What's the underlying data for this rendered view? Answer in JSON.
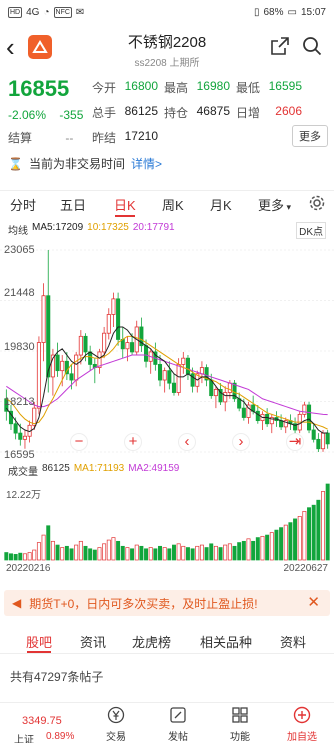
{
  "status_bar": {
    "left_chip": "HD",
    "carrier": "4G",
    "chip2": "NFC",
    "battery": "68%",
    "time": "15:07"
  },
  "header": {
    "title": "不锈钢2208",
    "subtitle": "ss2208 上期所"
  },
  "quote": {
    "price": "16855",
    "change_pct": "-2.06%",
    "change_abs": "-355",
    "rows": [
      [
        {
          "label": "今开",
          "value": "16800",
          "color": "green"
        },
        {
          "label": "最高",
          "value": "16980",
          "color": "green"
        },
        {
          "label": "最低",
          "value": "16595",
          "color": "green"
        }
      ],
      [
        {
          "label": "总手",
          "value": "86125",
          "color": "black"
        },
        {
          "label": "持仓",
          "value": "46875",
          "color": "black"
        },
        {
          "label": "日增",
          "value": "2606",
          "color": "red"
        }
      ],
      [
        {
          "label": "昨结",
          "value": "17210",
          "color": "black"
        }
      ]
    ],
    "settle_label": "结算",
    "settle_value": "--",
    "more_label": "更多"
  },
  "notice": {
    "text": "当前为非交易时间",
    "detail": "详情>"
  },
  "tabs": [
    "分时",
    "五日",
    "日K",
    "周K",
    "月K",
    "更多"
  ],
  "active_tab": "日K",
  "ma_legend": {
    "label": "均线",
    "ma5": "MA5:17209",
    "ma10": "10:17325",
    "ma20": "20:17791",
    "dk": "DK点"
  },
  "price_axis": [
    "23065",
    "21448",
    "19830",
    "18213",
    "16595"
  ],
  "chart_data": {
    "type": "candlestick",
    "x_start": "20220216",
    "x_end": "20220627",
    "ylim": [
      16595,
      23065
    ],
    "ohlc": [
      [
        18300,
        18600,
        17600,
        17900
      ],
      [
        17900,
        18100,
        17300,
        17500
      ],
      [
        17500,
        17700,
        17000,
        17200
      ],
      [
        17200,
        17500,
        16800,
        17000
      ],
      [
        17000,
        17300,
        16700,
        17100
      ],
      [
        17100,
        17600,
        16900,
        17450
      ],
      [
        17450,
        18200,
        17300,
        18000
      ],
      [
        18000,
        20300,
        17800,
        20100
      ],
      [
        20100,
        22000,
        19500,
        21600
      ],
      [
        21600,
        23065,
        18500,
        19000
      ],
      [
        19000,
        19900,
        18400,
        19700
      ],
      [
        19700,
        20100,
        19000,
        19200
      ],
      [
        19200,
        19700,
        18700,
        19500
      ],
      [
        19500,
        19800,
        18900,
        19100
      ],
      [
        19100,
        19400,
        18600,
        18900
      ],
      [
        18900,
        19800,
        18700,
        19700
      ],
      [
        19700,
        20500,
        19400,
        20300
      ],
      [
        20300,
        20400,
        19500,
        19800
      ],
      [
        19800,
        20000,
        19200,
        19400
      ],
      [
        19400,
        19600,
        18800,
        19300
      ],
      [
        19300,
        19900,
        19100,
        19800
      ],
      [
        19800,
        20600,
        19600,
        20400
      ],
      [
        20400,
        21200,
        20200,
        21000
      ],
      [
        21000,
        21700,
        20600,
        21500
      ],
      [
        21500,
        21700,
        20000,
        20200
      ],
      [
        20200,
        20600,
        19600,
        19900
      ],
      [
        19900,
        20300,
        19500,
        20100
      ],
      [
        20100,
        20400,
        19700,
        19800
      ],
      [
        19800,
        20800,
        19700,
        20600
      ],
      [
        20600,
        20900,
        19800,
        20000
      ],
      [
        20000,
        20200,
        19300,
        19500
      ],
      [
        19500,
        19900,
        19100,
        19800
      ],
      [
        19800,
        20100,
        19200,
        19400
      ],
      [
        19400,
        19700,
        18700,
        18900
      ],
      [
        18900,
        19300,
        18500,
        19200
      ],
      [
        19200,
        19500,
        18600,
        18800
      ],
      [
        18800,
        19100,
        18400,
        18500
      ],
      [
        18500,
        19600,
        18400,
        19400
      ],
      [
        19400,
        19800,
        19100,
        19600
      ],
      [
        19600,
        19700,
        18900,
        19100
      ],
      [
        19100,
        19300,
        18500,
        18700
      ],
      [
        18700,
        19200,
        18500,
        19100
      ],
      [
        19100,
        19500,
        18800,
        19300
      ],
      [
        19300,
        19400,
        18700,
        18900
      ],
      [
        18900,
        19100,
        18300,
        18400
      ],
      [
        18400,
        18700,
        18000,
        18600
      ],
      [
        18600,
        18800,
        18100,
        18200
      ],
      [
        18200,
        18700,
        17900,
        18500
      ],
      [
        18500,
        18900,
        18300,
        18800
      ],
      [
        18800,
        18900,
        18200,
        18300
      ],
      [
        18300,
        18500,
        17900,
        18000
      ],
      [
        18000,
        18300,
        17600,
        17700
      ],
      [
        17700,
        18200,
        17500,
        18100
      ],
      [
        18100,
        18400,
        17800,
        17900
      ],
      [
        17900,
        18100,
        17500,
        17600
      ],
      [
        17600,
        17900,
        17300,
        17800
      ],
      [
        17800,
        18000,
        17400,
        17500
      ],
      [
        17500,
        17800,
        17200,
        17700
      ],
      [
        17700,
        17900,
        17400,
        17600
      ],
      [
        17600,
        17800,
        17300,
        17400
      ],
      [
        17400,
        17700,
        17200,
        17600
      ],
      [
        17600,
        17800,
        17300,
        17500
      ],
      [
        17500,
        17700,
        17200,
        17300
      ],
      [
        17300,
        17900,
        17200,
        17800
      ],
      [
        17800,
        18200,
        17700,
        18100
      ],
      [
        18100,
        18200,
        17200,
        17300
      ],
      [
        17300,
        17500,
        16900,
        17000
      ],
      [
        17000,
        17200,
        16595,
        16700
      ],
      [
        16700,
        17300,
        16600,
        17200
      ],
      [
        17200,
        17300,
        16700,
        16855
      ]
    ],
    "volumes": [
      12,
      10,
      9,
      11,
      10,
      12,
      16,
      28,
      40,
      55,
      30,
      24,
      20,
      22,
      18,
      24,
      30,
      22,
      18,
      16,
      20,
      26,
      32,
      36,
      30,
      22,
      20,
      18,
      24,
      22,
      18,
      20,
      18,
      22,
      20,
      18,
      24,
      26,
      22,
      20,
      18,
      22,
      24,
      20,
      26,
      22,
      20,
      24,
      26,
      22,
      28,
      30,
      34,
      30,
      36,
      38,
      40,
      44,
      48,
      52,
      56,
      60,
      66,
      70,
      78,
      84,
      88,
      96,
      110,
      122
    ],
    "ma5": [
      18000,
      17800,
      17600,
      17400,
      17300,
      17250,
      17350,
      17700,
      18400,
      19200,
      19600,
      19800,
      19900,
      19700,
      19500,
      19400,
      19500,
      19700,
      19800,
      19700,
      19600,
      19700,
      20000,
      20400,
      20600,
      20600,
      20500,
      20300,
      20200,
      20100,
      20000,
      19900,
      19700,
      19600,
      19500,
      19300,
      19100,
      19000,
      19000,
      19100,
      19000,
      18900,
      19000,
      19000,
      18900,
      18700,
      18500,
      18400,
      18400,
      18400,
      18300,
      18200,
      18000,
      17900,
      17800,
      17700,
      17700,
      17650,
      17650,
      17600,
      17550,
      17500,
      17450,
      17500,
      17600,
      17650,
      17500,
      17300,
      17200,
      17209
    ],
    "ma10": [
      18300,
      18200,
      18000,
      17800,
      17650,
      17550,
      17500,
      17550,
      17750,
      18050,
      18300,
      18600,
      18900,
      19200,
      19400,
      19500,
      19600,
      19650,
      19650,
      19600,
      19600,
      19650,
      19750,
      19900,
      20100,
      20200,
      20300,
      20300,
      20250,
      20200,
      20100,
      20000,
      19900,
      19800,
      19700,
      19600,
      19500,
      19400,
      19300,
      19250,
      19150,
      19050,
      19000,
      18950,
      18900,
      18850,
      18750,
      18650,
      18600,
      18500,
      18450,
      18350,
      18250,
      18150,
      18050,
      17950,
      17850,
      17800,
      17750,
      17700,
      17650,
      17600,
      17550,
      17550,
      17550,
      17550,
      17500,
      17450,
      17400,
      17325
    ],
    "ma20": [
      18700,
      18600,
      18500,
      18400,
      18300,
      18200,
      18100,
      18050,
      18050,
      18100,
      18200,
      18300,
      18450,
      18600,
      18750,
      18900,
      19000,
      19100,
      19200,
      19300,
      19350,
      19400,
      19450,
      19500,
      19550,
      19600,
      19650,
      19700,
      19700,
      19700,
      19700,
      19650,
      19600,
      19550,
      19500,
      19450,
      19400,
      19350,
      19300,
      19250,
      19200,
      19150,
      19100,
      19050,
      19000,
      18950,
      18900,
      18850,
      18800,
      18750,
      18700,
      18650,
      18600,
      18500,
      18400,
      18300,
      18250,
      18200,
      18150,
      18100,
      18050,
      18000,
      17950,
      17900,
      17880,
      17860,
      17840,
      17820,
      17800,
      17791
    ]
  },
  "vol_legend": {
    "label": "成交量",
    "val": "86125",
    "ma1": "MA1:71193",
    "ma2": "MA2:49159",
    "axis_max": "12.22万"
  },
  "dates": {
    "start": "20220216",
    "end": "20220627"
  },
  "promo": {
    "text": "期货T+0，日内可多次买卖，及时止盈止损!",
    "close": "✕"
  },
  "bottom_tabs": [
    "股吧",
    "资讯",
    "龙虎榜",
    "相关品种",
    "资料"
  ],
  "active_bottom_tab": "股吧",
  "posts": "共有47297条帖子",
  "bottom_bar": {
    "index_value": "3349.75",
    "index_name": "上证",
    "index_chg": "0.89%",
    "items": [
      "交易",
      "发帖",
      "功能",
      "加自选"
    ]
  },
  "colors": {
    "up": "#e23434",
    "down": "#12a53c",
    "ma5": "#222222",
    "ma10": "#e0a000",
    "ma20": "#c23ad6",
    "accent": "#e23434"
  }
}
